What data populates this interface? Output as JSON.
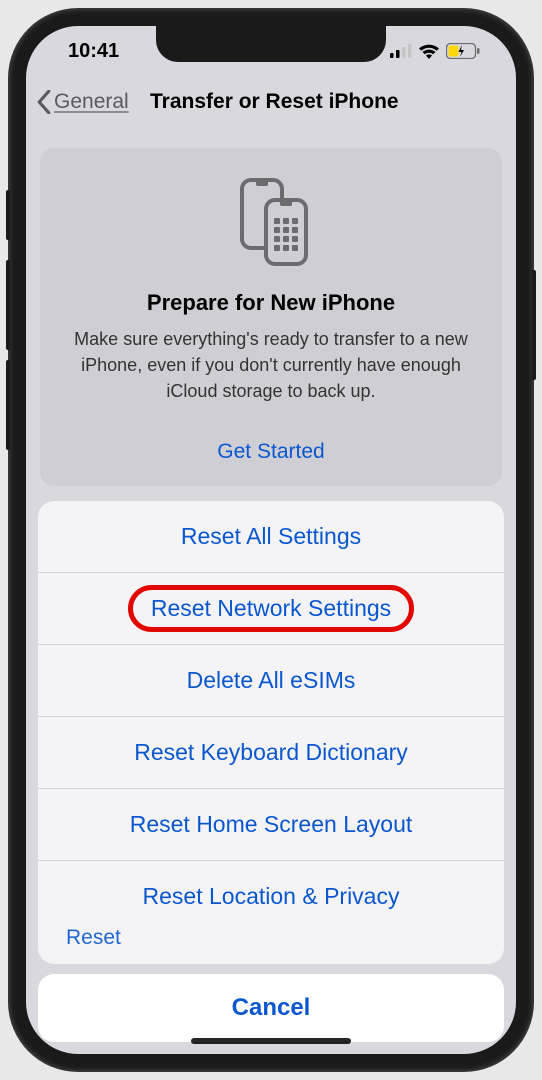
{
  "status": {
    "time": "10:41"
  },
  "nav": {
    "back_label": "General",
    "title": "Transfer or Reset iPhone"
  },
  "card": {
    "title": "Prepare for New iPhone",
    "body": "Make sure everything's ready to transfer to a new iPhone, even if you don't currently have enough iCloud storage to back up.",
    "action": "Get Started"
  },
  "sheet": {
    "options": [
      "Reset All Settings",
      "Reset Network Settings",
      "Delete All eSIMs",
      "Reset Keyboard Dictionary",
      "Reset Home Screen Layout",
      "Reset Location & Privacy"
    ],
    "peek": "Reset",
    "cancel": "Cancel"
  },
  "colors": {
    "accent": "#0b57d0",
    "highlight": "#e10600"
  }
}
